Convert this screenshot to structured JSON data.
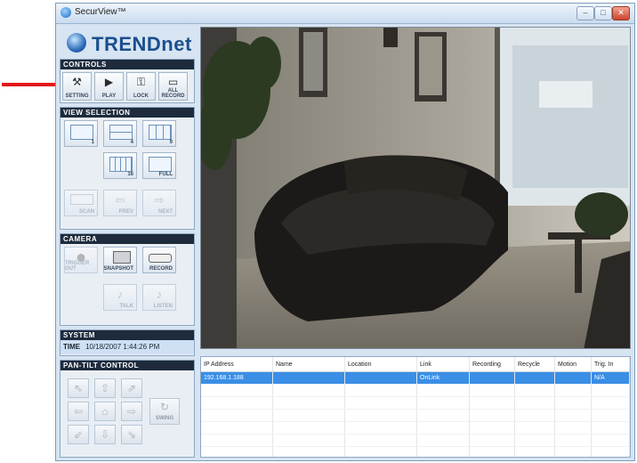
{
  "window": {
    "title": "SecurView™",
    "controls": [
      "minimize-icon",
      "maximize-icon",
      "close-icon"
    ]
  },
  "logo": "TRENDnet",
  "controls": {
    "header": "CONTROLS",
    "buttons": [
      {
        "label": "SETTING",
        "icon": "setting-icon"
      },
      {
        "label": "PLAY",
        "icon": "play-icon"
      },
      {
        "label": "LOCK",
        "icon": "lock-icon"
      },
      {
        "label": "ALL RECORD",
        "icon": "record-all-icon"
      }
    ]
  },
  "view_selection": {
    "header": "VIEW SELECTION",
    "layouts": [
      "1",
      "4",
      "9",
      "16",
      "FULL"
    ],
    "nav": [
      "SCAN",
      "PREV",
      "NEXT"
    ]
  },
  "camera": {
    "header": "CAMERA",
    "buttons": [
      "TRIGGER OUT",
      "SNAPSHOT",
      "RECORD",
      "TALK",
      "LISTEN"
    ]
  },
  "system": {
    "header": "SYSTEM",
    "time_label": "TIME",
    "time_value": "10/18/2007 1:44:26 PM"
  },
  "pan_tilt": {
    "header": "PAN-TILT CONTROL",
    "swing_label": "SWING"
  },
  "table": {
    "columns": [
      "IP Address",
      "Name",
      "Location",
      "Link",
      "Recording",
      "Recycle",
      "Motion",
      "Trig. In"
    ],
    "rows": [
      [
        "192.168.1.188",
        "",
        "",
        "OnLink",
        "",
        "",
        "",
        "N/A"
      ]
    ]
  },
  "colors": {
    "accent": "#3a8ee6",
    "annotation_arrow": "#e3171a"
  }
}
